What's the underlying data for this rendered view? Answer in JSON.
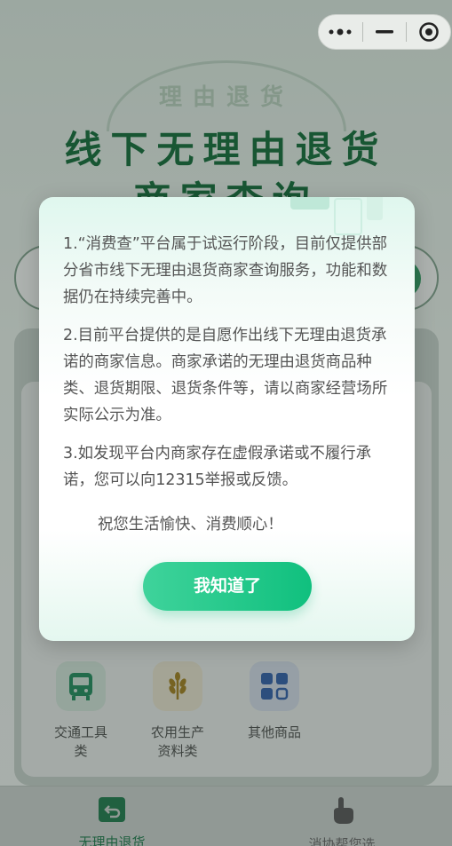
{
  "hero": {
    "watermark": "理由退货",
    "title_line1": "线下无理由退货",
    "title_line2": "商家查询"
  },
  "categories": [
    {
      "label": "交通工具\n类",
      "icon": "bus-icon"
    },
    {
      "label": "农用生产\n资料类",
      "icon": "wheat-icon"
    },
    {
      "label": "其他商品",
      "icon": "grid-icon"
    }
  ],
  "bottom_nav": [
    {
      "label": "无理由退货",
      "icon": "return-icon"
    },
    {
      "label": "消协帮您选",
      "icon": "hand-pointer-icon"
    }
  ],
  "modal": {
    "paragraphs": [
      "1.“消费查”平台属于试运行阶段，目前仅提供部分省市线下无理由退货商家查询服务，功能和数据仍在持续完善中。",
      "2.目前平台提供的是自愿作出线下无理由退货承诺的商家信息。商家承诺的无理由退货商品种类、退货期限、退货条件等，请以商家经营场所实际公示为准。",
      "3.如发现平台内商家存在虚假承诺或不履行承诺，您可以向12315举报或反馈。"
    ],
    "wish": "祝您生活愉快、消费顺心！",
    "ok_label": "我知道了"
  },
  "colors": {
    "accent": "#10c07e",
    "title_green": "#106b37"
  }
}
